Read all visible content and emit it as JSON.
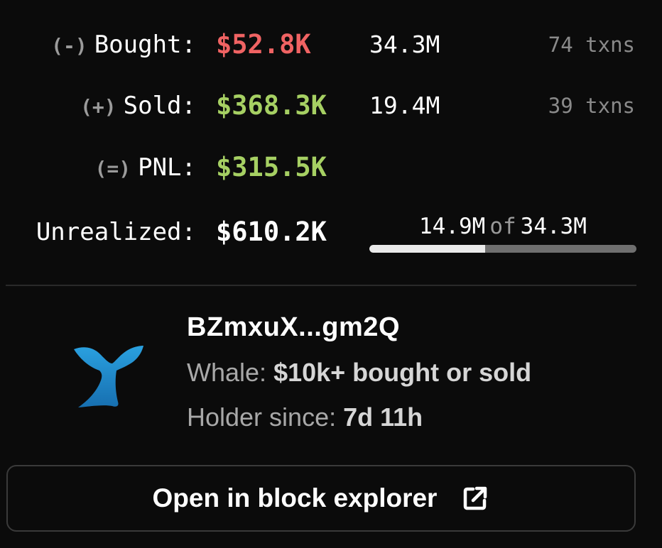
{
  "stats": {
    "bought": {
      "sign": "(-)",
      "label": "Bought:",
      "value": "$52.8K",
      "amount": "34.3M",
      "txns": "74 txns"
    },
    "sold": {
      "sign": "(+)",
      "label": "Sold:",
      "value": "$368.3K",
      "amount": "19.4M",
      "txns": "39 txns"
    },
    "pnl": {
      "sign": "(=)",
      "label": "PNL:",
      "value": "$315.5K"
    },
    "unrealized": {
      "label": "Unrealized:",
      "value": "$610.2K",
      "held": "14.9M",
      "of_label": "of",
      "total": "34.3M",
      "progress_fraction": 0.434
    }
  },
  "wallet": {
    "address": "BZmxuX...gm2Q",
    "whale_label": "Whale:",
    "whale_value": "$10k+ bought or sold",
    "holder_label": "Holder since:",
    "holder_value": "7d 11h",
    "icon": "whale-tail-icon"
  },
  "actions": {
    "explorer_label": "Open in block explorer",
    "explorer_icon": "external-link-icon"
  },
  "colors": {
    "negative": "#f06363",
    "positive": "#a6d063",
    "whale": "#1f8fd0",
    "background": "#0b0b0b"
  }
}
